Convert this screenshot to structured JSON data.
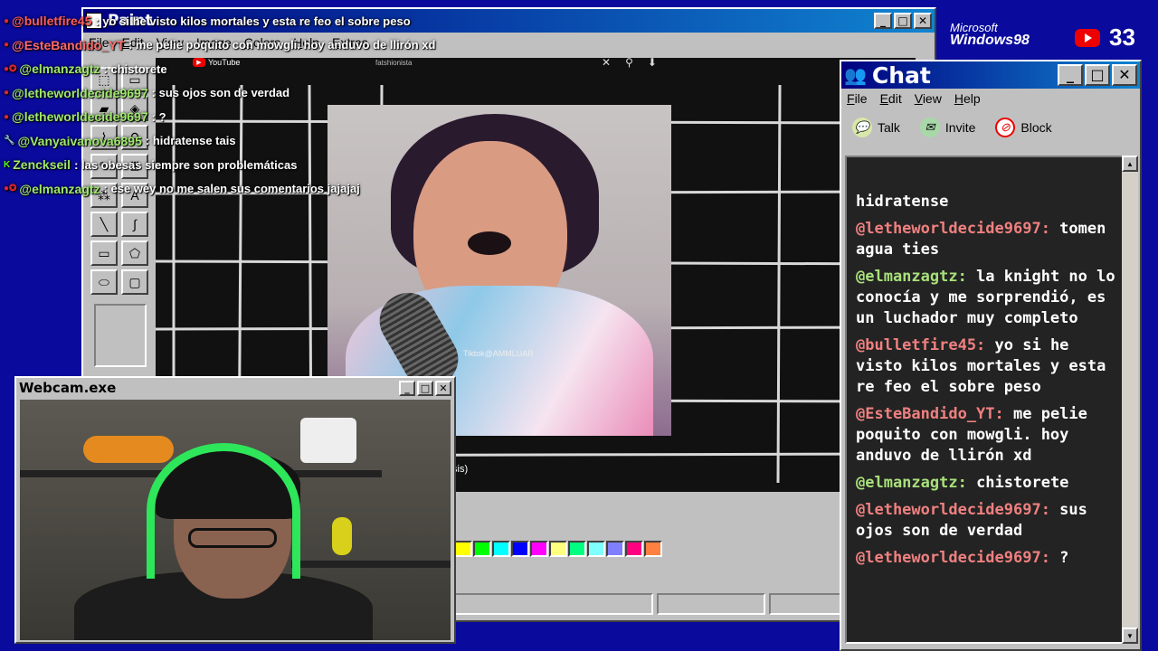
{
  "overlay_chat": [
    {
      "badge": "●",
      "badge_color": "#e0282d",
      "user": "@bulletfire45",
      "user_color": "#ff5c5c",
      "text": ": yo si he visto kilos mortales y esta re feo el sobre peso"
    },
    {
      "badge": "●",
      "badge_color": "#e0282d",
      "user": "@EsteBandido_YT",
      "user_color": "#ff6b6b",
      "text": ": me pelie poquito con mowgli. hoy anduvo de llirón xd"
    },
    {
      "badge": "●✪",
      "badge_color": "#e0282d",
      "user": "@elmanzagtz",
      "user_color": "#9ee86b",
      "text": ": chistorete"
    },
    {
      "badge": "●",
      "badge_color": "#e0282d",
      "user": "@letheworldecide9697",
      "user_color": "#9ee86b",
      "text": ": sus ojos son de verdad"
    },
    {
      "badge": "●",
      "badge_color": "#e0282d",
      "user": "@letheworldecide9697",
      "user_color": "#9ee86b",
      "text": ": ?"
    },
    {
      "badge": "🔧",
      "badge_color": "#7aa0ff",
      "user": "@Vanyaivanova6895",
      "user_color": "#9ee86b",
      "text": ": hidratense tais"
    },
    {
      "badge": "K",
      "badge_color": "#53fc18",
      "user": "Zenckseil",
      "user_color": "#9ee86b",
      "text": ": las obesas siempre son problemáticas"
    },
    {
      "badge": "●✪",
      "badge_color": "#e0282d",
      "user": "@elmanzagtz",
      "user_color": "#9ee86b",
      "text": ": ese wey no me salen sus comentarios jajajaj"
    }
  ],
  "paint": {
    "title": "Paint",
    "menu": [
      "File",
      "Edit",
      "View",
      "Image",
      "Colors",
      "Help",
      "Extras"
    ],
    "yt_label": "YouTube",
    "search_text": "fatshionista",
    "watermark": "Tiktok@AMMLUAR",
    "crisis_text": "sis)",
    "palette": [
      "#ffff00",
      "#00ff00",
      "#00ffff",
      "#0000ff",
      "#ff00ff",
      "#ffff80",
      "#00ff80",
      "#80ffff",
      "#8080ff",
      "#ff0080",
      "#ff8040"
    ]
  },
  "brand": {
    "ms_line": "Microsoft",
    "win_line": "Windows98",
    "follower_count": "33"
  },
  "chat": {
    "title": "Chat",
    "menu": [
      "File",
      "Edit",
      "View",
      "Help"
    ],
    "tools": {
      "talk": "Talk",
      "invite": "Invite",
      "block": "Block"
    },
    "messages": [
      {
        "user": "",
        "user_color": "#ffffff",
        "text": "hidratense"
      },
      {
        "user": "@letheworldecide9697:",
        "user_color": "#f08080",
        "text": "tomen agua ties"
      },
      {
        "user": "@elmanzagtz:",
        "user_color": "#a8e07a",
        "text": "la knight no lo conocía y me sorprendió, es un luchador muy completo"
      },
      {
        "user": "@bulletfire45:",
        "user_color": "#f08080",
        "text": "yo si he visto kilos mortales y esta re feo el sobre peso"
      },
      {
        "user": "@EsteBandido_YT:",
        "user_color": "#f08080",
        "text": "me pelie poquito con mowgli. hoy anduvo de llirón xd"
      },
      {
        "user": "@elmanzagtz:",
        "user_color": "#a8e07a",
        "text": "chistorete"
      },
      {
        "user": "@letheworldecide9697:",
        "user_color": "#f08080",
        "text": "sus ojos son de verdad"
      },
      {
        "user": "@letheworldecide9697:",
        "user_color": "#f08080",
        "text": "?"
      }
    ]
  },
  "webcam": {
    "title": "Webcam.exe"
  }
}
